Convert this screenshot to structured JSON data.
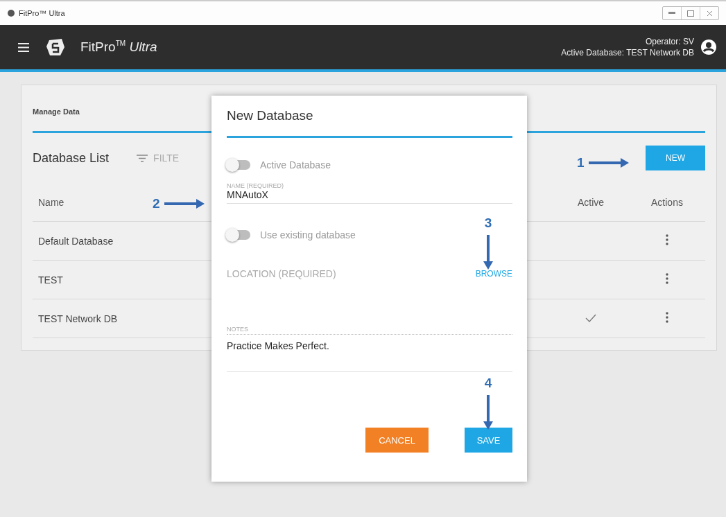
{
  "window": {
    "title": "FitPro™ Ultra"
  },
  "header": {
    "brand": "FitPro",
    "brand_mark": "TM",
    "brand_suffix": "Ultra",
    "operator_label": "Operator:",
    "operator": "SV",
    "database_label": "Active Database:",
    "database": "TEST Network DB"
  },
  "page": {
    "section": "Manage Data",
    "list_title": "Database List",
    "filter": "FILTE",
    "new_button": "NEW",
    "columns": [
      "Name",
      "Active",
      "Actions"
    ],
    "rows": [
      {
        "name": "Default Database",
        "active": false
      },
      {
        "name": "TEST",
        "active": false
      },
      {
        "name": "TEST Network DB",
        "active": true
      }
    ]
  },
  "dialog": {
    "title": "New Database",
    "active_toggle": {
      "label": "Active Database",
      "on": false
    },
    "name_field": {
      "label": "NAME (REQUIRED)",
      "value": "MNAutoX"
    },
    "existing_toggle": {
      "label": "Use existing database",
      "on": false
    },
    "location": {
      "label": "LOCATION (REQUIRED)",
      "button": "BROWSE"
    },
    "notes": {
      "label": "NOTES",
      "value": "Practice Makes Perfect."
    },
    "buttons": {
      "cancel": "CANCEL",
      "save": "SAVE"
    }
  },
  "annotations": [
    {
      "label": "1",
      "kind": "right"
    },
    {
      "label": "2",
      "kind": "right"
    },
    {
      "label": "3",
      "kind": "down"
    },
    {
      "label": "4",
      "kind": "down"
    }
  ]
}
